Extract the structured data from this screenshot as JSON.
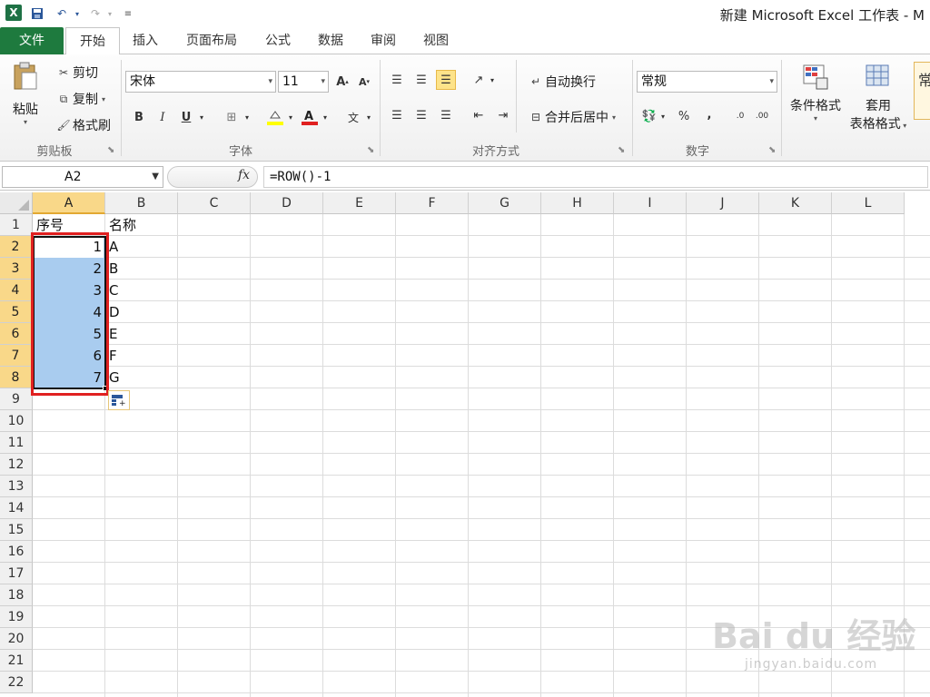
{
  "title": "新建 Microsoft Excel 工作表 - M",
  "quick_access": {
    "logo": "X"
  },
  "tabs": {
    "file": "文件",
    "home": "开始",
    "insert": "插入",
    "page_layout": "页面布局",
    "formulas": "公式",
    "data": "数据",
    "review": "审阅",
    "view": "视图"
  },
  "ribbon": {
    "clipboard": {
      "paste": "粘贴",
      "cut": "剪切",
      "copy": "复制",
      "format_painter": "格式刷",
      "label": "剪贴板"
    },
    "font": {
      "name": "宋体",
      "size": "11",
      "bold": "B",
      "italic": "I",
      "underline": "U",
      "label": "字体"
    },
    "alignment": {
      "wrap_text": "自动换行",
      "merge_center": "合并后居中",
      "label": "对齐方式"
    },
    "number": {
      "format": "常规",
      "percent": "%",
      "comma": ",",
      "label": "数字"
    },
    "styles": {
      "conditional": "条件格式",
      "table_1": "套用",
      "table_2": "表格格式",
      "cell_style": "常"
    }
  },
  "formula_bar": {
    "name_box": "A2",
    "fx": "fx",
    "formula": "=ROW()-1"
  },
  "grid": {
    "columns": [
      "A",
      "B",
      "C",
      "D",
      "E",
      "F",
      "G",
      "H",
      "I",
      "J",
      "K",
      "L"
    ],
    "rows": [
      "1",
      "2",
      "3",
      "4",
      "5",
      "6",
      "7",
      "8",
      "9",
      "10",
      "11",
      "12",
      "13",
      "14",
      "15",
      "16",
      "17",
      "18",
      "19",
      "20",
      "21",
      "22"
    ],
    "header_row": {
      "a": "序号",
      "b": "名称"
    },
    "data": [
      {
        "a": "1",
        "b": "A"
      },
      {
        "a": "2",
        "b": "B"
      },
      {
        "a": "3",
        "b": "C"
      },
      {
        "a": "4",
        "b": "D"
      },
      {
        "a": "5",
        "b": "E"
      },
      {
        "a": "6",
        "b": "F"
      },
      {
        "a": "7",
        "b": "G"
      }
    ]
  },
  "watermark": {
    "main": "Bai du 经验",
    "sub": "jingyan.baidu.com"
  },
  "colors": {
    "file_tab": "#1e7a3e",
    "selection": "#a9ccef",
    "header_selected": "#f9d889",
    "highlight": "#e02020"
  }
}
